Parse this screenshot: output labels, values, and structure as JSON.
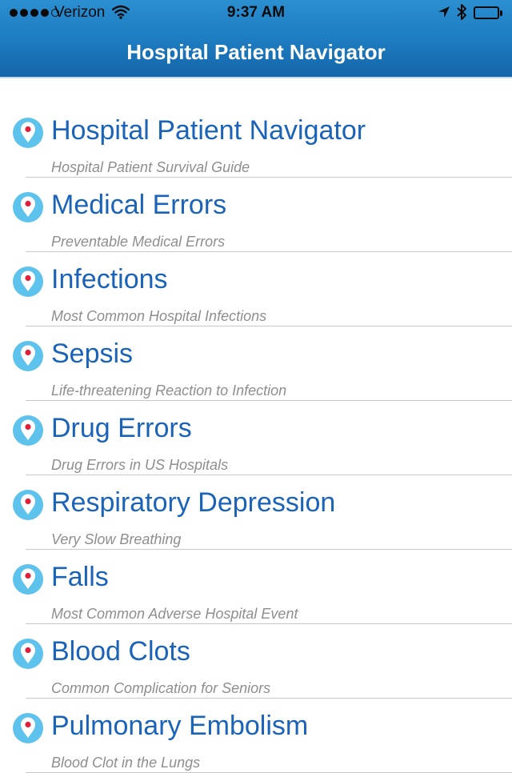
{
  "status_bar": {
    "carrier": "Verizon",
    "time": "9:37 AM",
    "signal_bars_filled": 4,
    "signal_bars_total": 5,
    "battery_level": 1.0
  },
  "nav": {
    "title": "Hospital Patient Navigator",
    "background_color": "#1f7fc4"
  },
  "colors": {
    "title_text": "#1a63b8",
    "subtitle_text": "#8e8e8e",
    "pin_icon": "#5ec3ec",
    "pin_dot": "#e0203a"
  },
  "items": [
    {
      "title": "Hospital Patient Navigator",
      "subtitle": "Hospital Patient Survival Guide",
      "icon": "map-pin-icon"
    },
    {
      "title": "Medical Errors",
      "subtitle": "Preventable Medical Errors",
      "icon": "map-pin-icon"
    },
    {
      "title": "Infections",
      "subtitle": "Most Common Hospital Infections",
      "icon": "map-pin-icon"
    },
    {
      "title": "Sepsis",
      "subtitle": "Life-threatening Reaction to Infection",
      "icon": "map-pin-icon"
    },
    {
      "title": "Drug Errors",
      "subtitle": "Drug Errors in US Hospitals",
      "icon": "map-pin-icon"
    },
    {
      "title": "Respiratory Depression",
      "subtitle": "Very Slow Breathing",
      "icon": "map-pin-icon"
    },
    {
      "title": "Falls",
      "subtitle": "Most Common Adverse Hospital Event",
      "icon": "map-pin-icon"
    },
    {
      "title": "Blood Clots",
      "subtitle": "Common Complication for Seniors",
      "icon": "map-pin-icon"
    },
    {
      "title": "Pulmonary Embolism",
      "subtitle": "Blood Clot in the Lungs",
      "icon": "map-pin-icon"
    }
  ]
}
